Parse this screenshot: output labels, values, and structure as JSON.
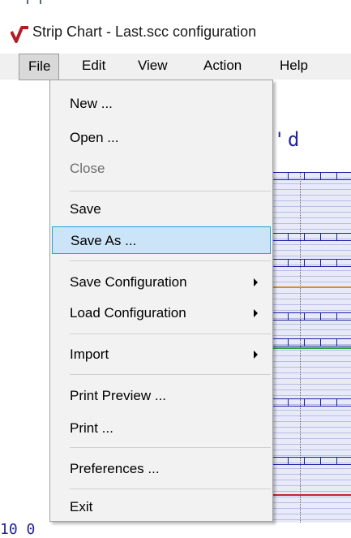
{
  "window": {
    "title": "Strip Chart - Last.scc configuration"
  },
  "menubar": {
    "items": [
      {
        "label": "File",
        "active": true
      },
      {
        "label": "Edit"
      },
      {
        "label": "View"
      },
      {
        "label": "Action"
      },
      {
        "label": "Help"
      }
    ]
  },
  "background": {
    "status_text": "p'd",
    "bottom_text": "10 0",
    "trace_colors": {
      "orange": "#e08a1f",
      "green": "#2f9e44",
      "red": "#c8252c"
    }
  },
  "file_menu": {
    "items": [
      {
        "label": "New ..."
      },
      {
        "label": "Open ..."
      },
      {
        "label": "Close",
        "disabled": true
      },
      {
        "label": "Save"
      },
      {
        "label": "Save As ...",
        "highlighted": true
      },
      {
        "label": "Save Configuration",
        "submenu": true
      },
      {
        "label": "Load Configuration",
        "submenu": true
      },
      {
        "label": "Import",
        "submenu": true
      },
      {
        "label": "Print Preview ..."
      },
      {
        "label": "Print ..."
      },
      {
        "label": "Preferences ..."
      },
      {
        "label": "Exit"
      }
    ]
  },
  "colors": {
    "highlight_bg": "#cce4f7",
    "highlight_border": "#26a0da",
    "chart_blue": "#1a22a6"
  }
}
